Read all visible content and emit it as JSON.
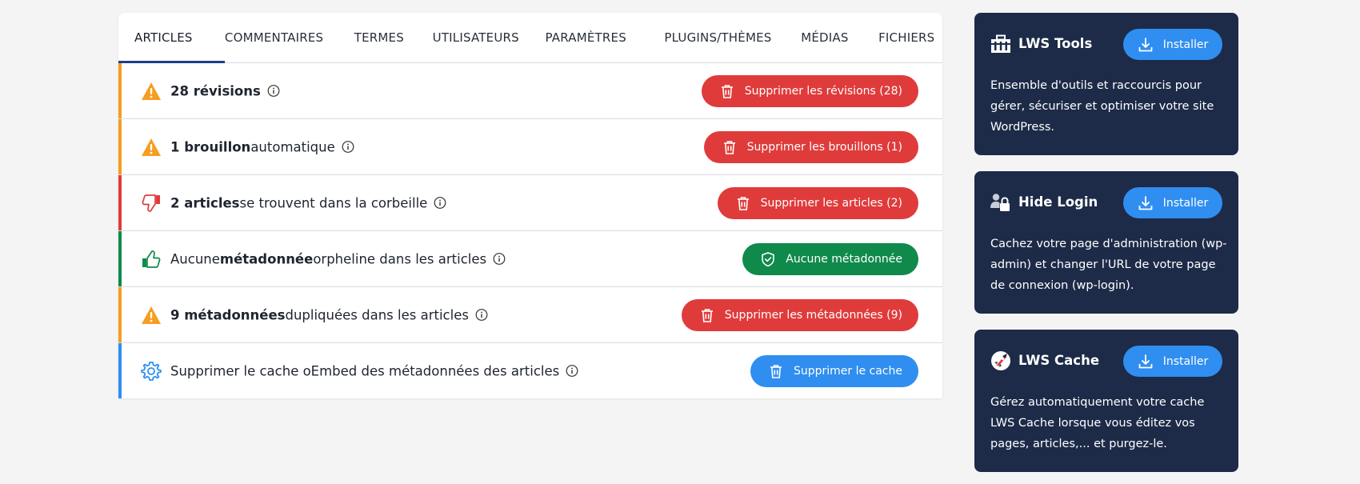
{
  "tabs": [
    {
      "label": "ARTICLES",
      "active": true
    },
    {
      "label": "COMMENTAIRES",
      "active": false
    },
    {
      "label": "TERMES",
      "active": false
    },
    {
      "label": "UTILISATEURS",
      "active": false
    },
    {
      "label": "PARAMÈTRES",
      "active": false
    },
    {
      "label": "PLUGINS/THÈMES",
      "active": false
    },
    {
      "label": "MÉDIAS",
      "active": false
    },
    {
      "label": "FICHIERS",
      "active": false
    }
  ],
  "rows": [
    {
      "icon": "warning-icon",
      "accent": "#f59e20",
      "bold": "28 révisions",
      "rest": "",
      "pre": "",
      "button": "Supprimer les révisions (28)",
      "button_color": "#e03b3b",
      "button_icon": "trash-icon"
    },
    {
      "icon": "warning-icon",
      "accent": "#f59e20",
      "bold": "1 brouillon",
      "rest": " automatique",
      "pre": "",
      "button": "Supprimer les brouillons (1)",
      "button_color": "#e03b3b",
      "button_icon": "trash-icon"
    },
    {
      "icon": "thumbs-down-icon",
      "accent": "#e03b3b",
      "bold": "2 articles",
      "rest": " se trouvent dans la corbeille",
      "pre": "",
      "button": "Supprimer les articles (2)",
      "button_color": "#e03b3b",
      "button_icon": "trash-icon"
    },
    {
      "icon": "thumbs-up-icon",
      "accent": "#0f8a4b",
      "pre": "Aucune ",
      "bold": "métadonnée",
      "rest": " orpheline dans les articles",
      "button": "Aucune métadonnée",
      "button_color": "#0f8a4b",
      "button_icon": "shield-check-icon"
    },
    {
      "icon": "warning-icon",
      "accent": "#f59e20",
      "bold": "9 métadonnées",
      "rest": " dupliquées dans les articles",
      "pre": "",
      "button": "Supprimer les métadonnées (9)",
      "button_color": "#e03b3b",
      "button_icon": "trash-icon"
    },
    {
      "icon": "gear-icon",
      "accent": "#2f8ef0",
      "pre": "Supprimer le cache oEmbed des métadonnées des articles",
      "bold": "",
      "rest": "",
      "button": "Supprimer le cache",
      "button_color": "#2f8ef0",
      "button_icon": "trash-icon"
    }
  ],
  "plugins": [
    {
      "icon": "toolbox-icon",
      "title": "LWS Tools",
      "install_label": "Installer",
      "description": "Ensemble d'outils et raccourcis pour gérer, sécuriser et optimiser votre site WordPress."
    },
    {
      "icon": "user-lock-icon",
      "title": "Hide Login",
      "install_label": "Installer",
      "description": "Cachez votre page d'administration (wp-admin) et changer l'URL de votre page de connexion (wp-login)."
    },
    {
      "icon": "rocket-icon",
      "title": "LWS Cache",
      "install_label": "Installer",
      "description": "Gérez automatiquement votre cache LWS Cache lorsque vous éditez vos pages, articles,... et purgez-le."
    }
  ],
  "colors": {
    "accent_tab": "#1c3d8c",
    "danger": "#e03b3b",
    "success": "#0f8a4b",
    "info": "#2f8ef0",
    "warning": "#f59e20",
    "sidebar_card": "#1d2b48"
  }
}
